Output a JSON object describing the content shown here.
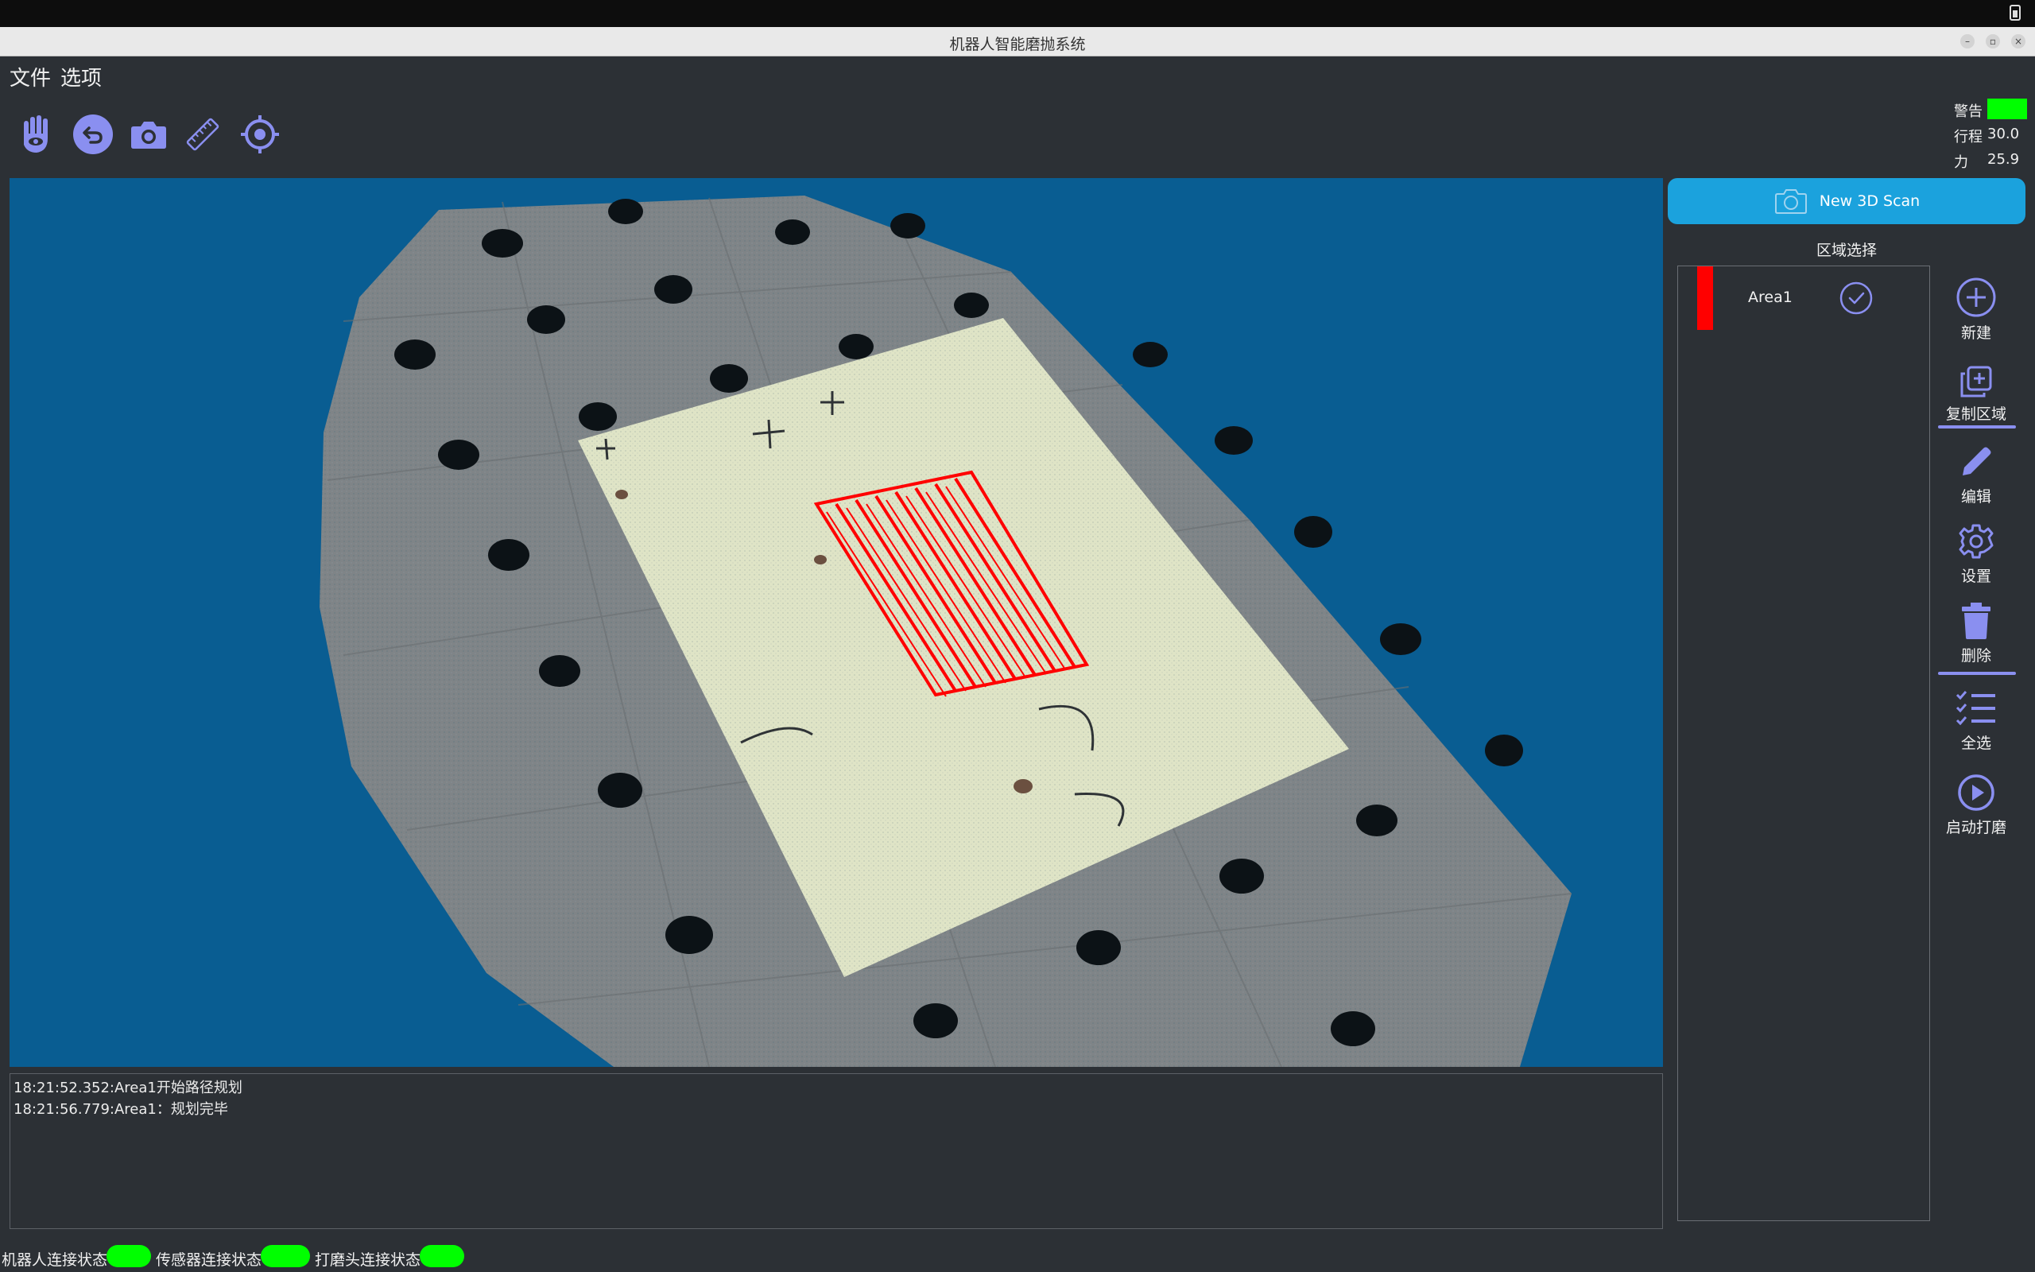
{
  "window": {
    "title": "机器人智能磨抛系统"
  },
  "menu": {
    "items": [
      "文件",
      "选项"
    ]
  },
  "toolbar": {
    "icons": [
      "hand-eye-icon",
      "undo-icon",
      "camera-icon",
      "ruler-icon",
      "target-icon"
    ]
  },
  "status_top": {
    "warning_label": "警告",
    "warning_color": "#00ff00",
    "stroke_label": "行程",
    "stroke_value": "30.0",
    "force_label": "力",
    "force_value": "25.9"
  },
  "scan_button": {
    "label": "New 3D Scan",
    "color": "#1ba2dd"
  },
  "area_panel": {
    "title": "区域选择",
    "items": [
      {
        "name": "Area1",
        "color": "#ff0000",
        "selected": true
      }
    ]
  },
  "side_buttons": {
    "new": "新建",
    "copy": "复制区域",
    "edit": "编辑",
    "settings": "设置",
    "delete": "删除",
    "select_all": "全选",
    "start": "启动打磨"
  },
  "log": [
    "18:21:52.352:Area1开始路径规划",
    "18:21:56.779:Area1：规划完毕"
  ],
  "footer": {
    "robot_label": "机器人连接状态",
    "sensor_label": "传感器连接状态",
    "head_label": "打磨头连接状态",
    "status_color": "#00ff00"
  },
  "colors": {
    "accent": "#8a8ff0",
    "viewport_bg": "#095d92",
    "path": "#ff0000"
  }
}
